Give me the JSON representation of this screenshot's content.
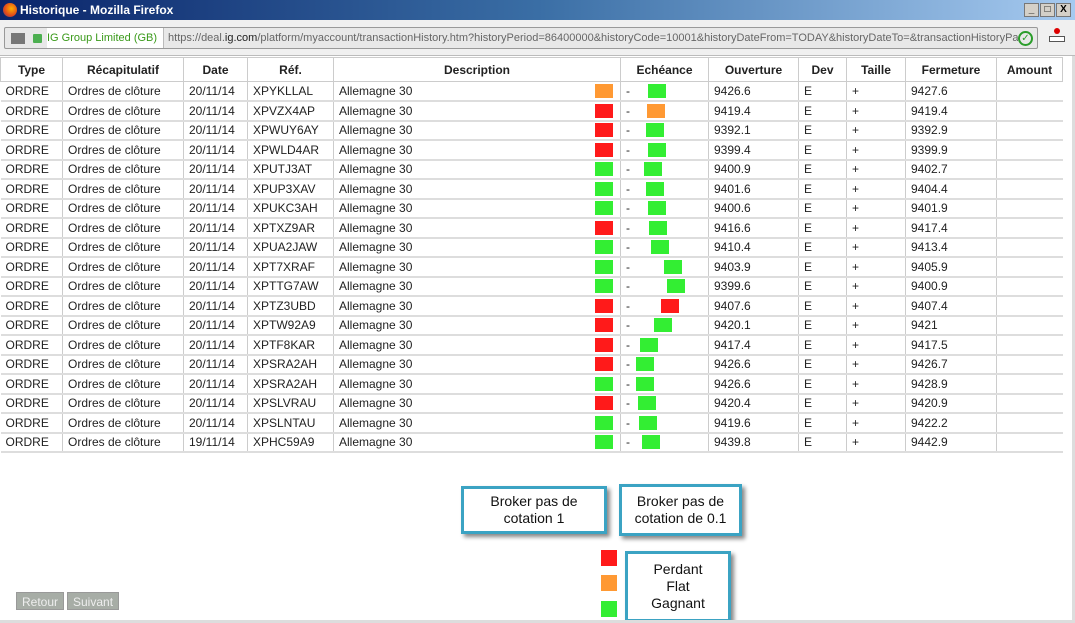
{
  "window": {
    "title": "Historique - Mozilla Firefox",
    "controls": [
      "_",
      "□",
      "X"
    ]
  },
  "toolbar": {
    "identity": "IG Group Limited (GB)",
    "url_prefix": "https://deal.",
    "url_domain": "ig.com",
    "url_rest": "/platform/myaccount/transactionHistory.htm?historyPeriod=86400000&historyCode=10001&historyDateFrom=TODAY&historyDateTo=&transactionHistoryPageNumber="
  },
  "table": {
    "headers": [
      "Type",
      "Récapitulatif",
      "Date",
      "Réf.",
      "Description",
      "Echéance",
      "Ouverture",
      "Dev",
      "Taille",
      "Fermeture",
      "Amount"
    ],
    "rows": [
      [
        "ORDRE",
        "Ordres de clôture",
        "20/11/14",
        "XPYKLLAL",
        "Allemagne 30",
        "-",
        "9426.6",
        "E",
        "+",
        "9427.6"
      ],
      [
        "ORDRE",
        "Ordres de clôture",
        "20/11/14",
        "XPVZX4AP",
        "Allemagne 30",
        "-",
        "9419.4",
        "E",
        "+",
        "9419.4"
      ],
      [
        "ORDRE",
        "Ordres de clôture",
        "20/11/14",
        "XPWUY6AY",
        "Allemagne 30",
        "-",
        "9392.1",
        "E",
        "+",
        "9392.9"
      ],
      [
        "ORDRE",
        "Ordres de clôture",
        "20/11/14",
        "XPWLD4AR",
        "Allemagne 30",
        "-",
        "9399.4",
        "E",
        "+",
        "9399.9"
      ],
      [
        "ORDRE",
        "Ordres de clôture",
        "20/11/14",
        "XPUTJ3AT",
        "Allemagne 30",
        "-",
        "9400.9",
        "E",
        "+",
        "9402.7"
      ],
      [
        "ORDRE",
        "Ordres de clôture",
        "20/11/14",
        "XPUP3XAV",
        "Allemagne 30",
        "-",
        "9401.6",
        "E",
        "+",
        "9404.4"
      ],
      [
        "ORDRE",
        "Ordres de clôture",
        "20/11/14",
        "XPUKC3AH",
        "Allemagne 30",
        "-",
        "9400.6",
        "E",
        "+",
        "9401.9"
      ],
      [
        "ORDRE",
        "Ordres de clôture",
        "20/11/14",
        "XPTXZ9AR",
        "Allemagne 30",
        "-",
        "9416.6",
        "E",
        "+",
        "9417.4"
      ],
      [
        "ORDRE",
        "Ordres de clôture",
        "20/11/14",
        "XPUA2JAW",
        "Allemagne 30",
        "-",
        "9410.4",
        "E",
        "+",
        "9413.4"
      ],
      [
        "ORDRE",
        "Ordres de clôture",
        "20/11/14",
        "XPT7XRAF",
        "Allemagne 30",
        "-",
        "9403.9",
        "E",
        "+",
        "9405.9"
      ],
      [
        "ORDRE",
        "Ordres de clôture",
        "20/11/14",
        "XPTTG7AW",
        "Allemagne 30",
        "-",
        "9399.6",
        "E",
        "+",
        "9400.9"
      ],
      [
        "ORDRE",
        "Ordres de clôture",
        "20/11/14",
        "XPTZ3UBD",
        "Allemagne 30",
        "-",
        "9407.6",
        "E",
        "+",
        "9407.4"
      ],
      [
        "ORDRE",
        "Ordres de clôture",
        "20/11/14",
        "XPTW92A9",
        "Allemagne 30",
        "-",
        "9420.1",
        "E",
        "+",
        "9421"
      ],
      [
        "ORDRE",
        "Ordres de clôture",
        "20/11/14",
        "XPTF8KAR",
        "Allemagne 30",
        "-",
        "9417.4",
        "E",
        "+",
        "9417.5"
      ],
      [
        "ORDRE",
        "Ordres de clôture",
        "20/11/14",
        "XPSRA2AH",
        "Allemagne 30",
        "-",
        "9426.6",
        "E",
        "+",
        "9426.7"
      ],
      [
        "ORDRE",
        "Ordres de clôture",
        "20/11/14",
        "XPSRA2AH",
        "Allemagne 30",
        "-",
        "9426.6",
        "E",
        "+",
        "9428.9"
      ],
      [
        "ORDRE",
        "Ordres de clôture",
        "20/11/14",
        "XPSLVRAU",
        "Allemagne 30",
        "-",
        "9420.4",
        "E",
        "+",
        "9420.9"
      ],
      [
        "ORDRE",
        "Ordres de clôture",
        "20/11/14",
        "XPSLNTAU",
        "Allemagne 30",
        "-",
        "9419.6",
        "E",
        "+",
        "9422.2"
      ],
      [
        "ORDRE",
        "Ordres de clôture",
        "19/11/14",
        "XPHC59A9",
        "Allemagne 30",
        "-",
        "9439.8",
        "E",
        "+",
        "9442.9"
      ]
    ]
  },
  "markers": {
    "colors": {
      "perdant": "#ff1a1a",
      "flat": "#ff9933",
      "gagnant": "#33ee33"
    },
    "broker_tick_1": [
      "flat",
      "perdant",
      "perdant",
      "perdant",
      "gagnant",
      "gagnant",
      "gagnant",
      "perdant",
      "gagnant",
      "gagnant",
      "gagnant",
      "perdant",
      "perdant",
      "perdant",
      "perdant",
      "gagnant",
      "perdant",
      "gagnant",
      "gagnant"
    ],
    "broker_tick_01": [
      "gagnant",
      "flat",
      "gagnant",
      "gagnant",
      "gagnant",
      "gagnant",
      "gagnant",
      "gagnant",
      "gagnant",
      "gagnant",
      "gagnant",
      "perdant",
      "gagnant",
      "gagnant",
      "gagnant",
      "gagnant",
      "gagnant",
      "gagnant",
      "gagnant"
    ]
  },
  "annotations": {
    "broker1": "Broker pas de cotation 1",
    "broker01": "Broker pas de cotation de 0.1",
    "legend": [
      "Perdant",
      "Flat",
      "Gagnant"
    ]
  },
  "pager": {
    "back": "Retour",
    "next": "Suivant"
  }
}
